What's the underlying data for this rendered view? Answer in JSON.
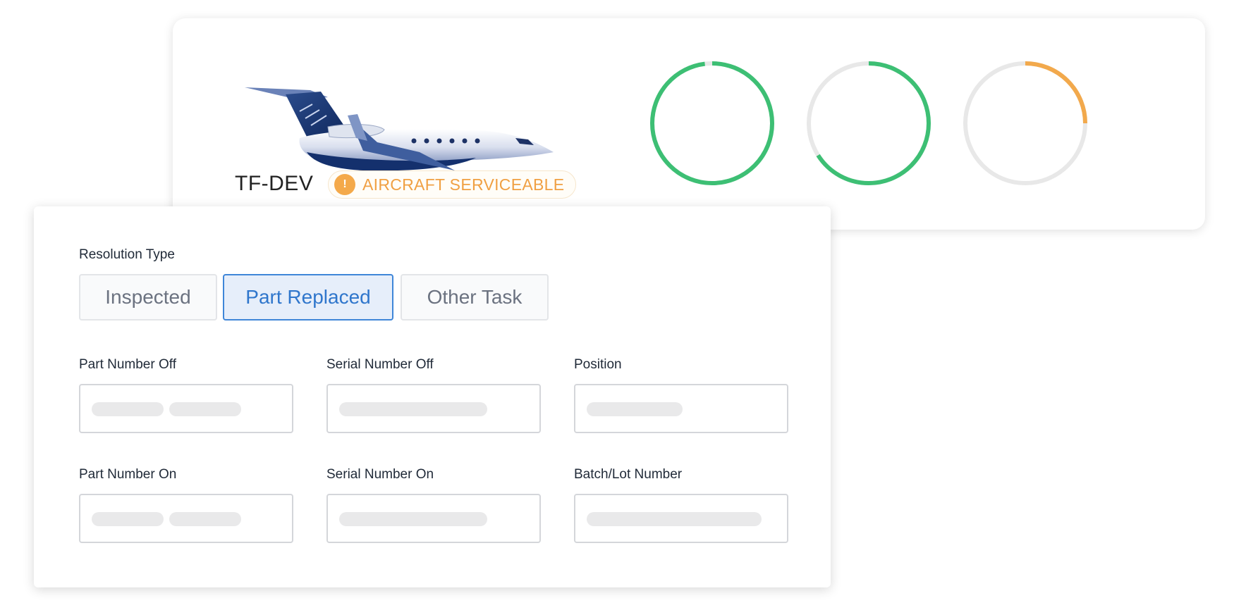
{
  "aircraft": {
    "registration": "TF-DEV",
    "status_label": "AIRCRAFT SERVICEABLE",
    "status_icon": "exclamation-icon",
    "status_color": "#f0a043",
    "gauges": [
      {
        "name": "gauge-1",
        "fraction": 0.98,
        "color": "#3dbf74"
      },
      {
        "name": "gauge-2",
        "fraction": 0.66,
        "color": "#3dbf74"
      },
      {
        "name": "gauge-3",
        "fraction": 0.25,
        "color": "#f2a94c"
      }
    ]
  },
  "form": {
    "resolution_type_label": "Resolution Type",
    "resolution_options": [
      "Inspected",
      "Part Replaced",
      "Other Task"
    ],
    "selected_option": "Part Replaced",
    "fields": {
      "part_number_off": "Part Number Off",
      "serial_number_off": "Serial Number Off",
      "position": "Position",
      "part_number_on": "Part Number On",
      "serial_number_on": "Serial Number On",
      "batch_lot_number": "Batch/Lot Number"
    }
  },
  "colors": {
    "accent": "#2f76cc",
    "success": "#3dbf74",
    "warning": "#f2a94c"
  }
}
